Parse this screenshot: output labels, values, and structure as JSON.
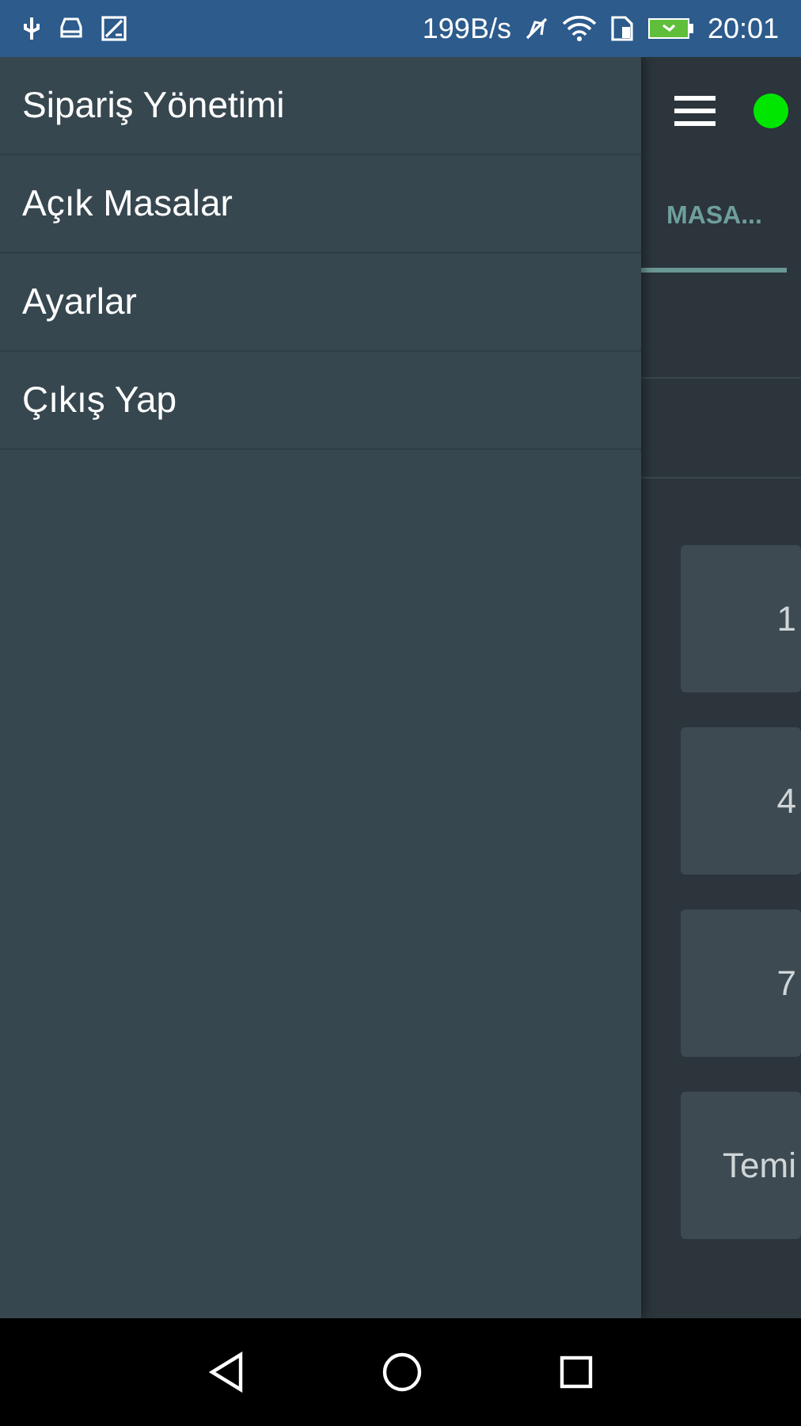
{
  "status_bar": {
    "speed": "199B/s",
    "time": "20:01"
  },
  "drawer": {
    "items": [
      {
        "label": "Sipariş Yönetimi"
      },
      {
        "label": "Açık Masalar"
      },
      {
        "label": "Ayarlar"
      },
      {
        "label": "Çıkış Yap"
      }
    ]
  },
  "toolbar": {
    "connected": true
  },
  "tabs": [
    {
      "label": "MASA...",
      "selected": true
    }
  ],
  "keypad": [
    "1",
    "4",
    "7",
    "Temi"
  ]
}
